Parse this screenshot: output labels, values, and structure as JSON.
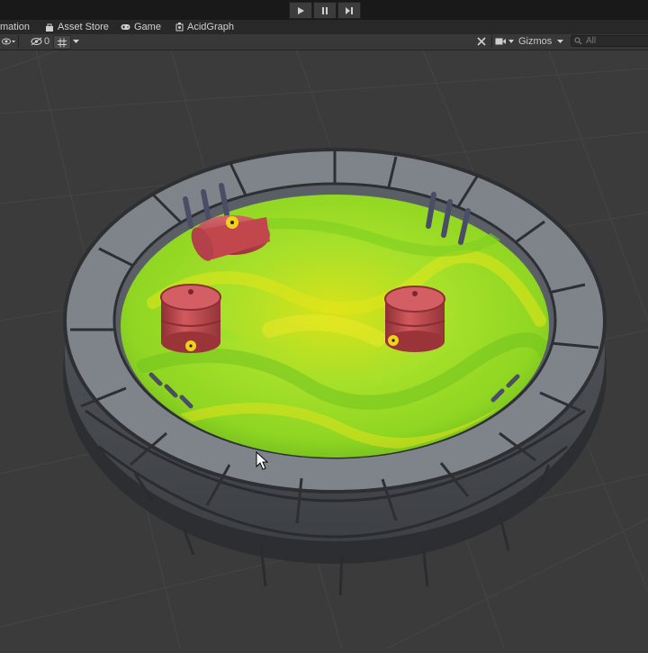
{
  "playbar": {
    "play": "play-icon",
    "pause": "pause-icon",
    "step": "step-icon"
  },
  "tabs": [
    {
      "label": "mation",
      "icon": "animation-icon"
    },
    {
      "label": "Asset Store",
      "icon": "asset-store-icon"
    },
    {
      "label": "Game",
      "icon": "game-controller-icon"
    },
    {
      "label": "AcidGraph",
      "icon": "shader-graph-icon"
    }
  ],
  "toolbar": {
    "hidden_count": "0",
    "gizmos_label": "Gizmos",
    "search_placeholder": "All"
  },
  "colors": {
    "acid": "#9fe01f",
    "barrel": "#c14a4e",
    "stone": "#6e7278",
    "grid_bg": "#3b3b3b"
  }
}
